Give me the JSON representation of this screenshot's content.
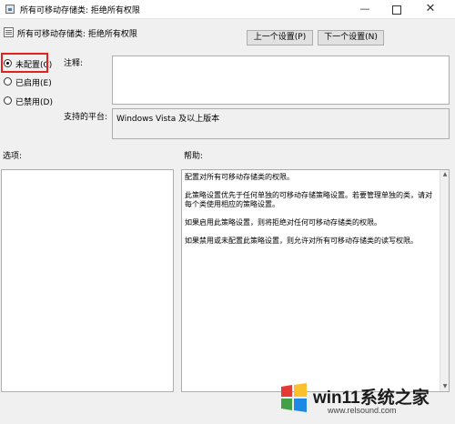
{
  "window": {
    "title": "所有可移动存储类: 拒绝所有权限",
    "controls": {
      "minimize": "—",
      "close": "✕"
    }
  },
  "header": {
    "title": "所有可移动存储类: 拒绝所有权限",
    "prev_label": "上一个设置(P)",
    "next_label": "下一个设置(N)"
  },
  "state": {
    "options": [
      {
        "label": "未配置(C)",
        "checked": true
      },
      {
        "label": "已启用(E)",
        "checked": false
      },
      {
        "label": "已禁用(D)",
        "checked": false
      }
    ]
  },
  "comment": {
    "label": "注释:",
    "value": ""
  },
  "platform": {
    "label": "支持的平台:",
    "value": "Windows Vista 及以上版本"
  },
  "options_section": {
    "label": "选项:"
  },
  "help_section": {
    "label": "帮助:",
    "paragraphs": [
      "配置对所有可移动存储类的权限。",
      "此策略设置优先于任何单独的可移动存储策略设置。若要管理单独的类，请对每个类使用相应的策略设置。",
      "如果启用此策略设置，则将拒绝对任何可移动存储类的权限。",
      "如果禁用或未配置此策略设置，则允许对所有可移动存储类的读写权限。"
    ]
  },
  "watermark": {
    "brand": "win11系统之家",
    "url": "www.relsound.com",
    "colors": [
      "#e53935",
      "#fbc02d",
      "#43a047",
      "#1e88e5"
    ]
  }
}
